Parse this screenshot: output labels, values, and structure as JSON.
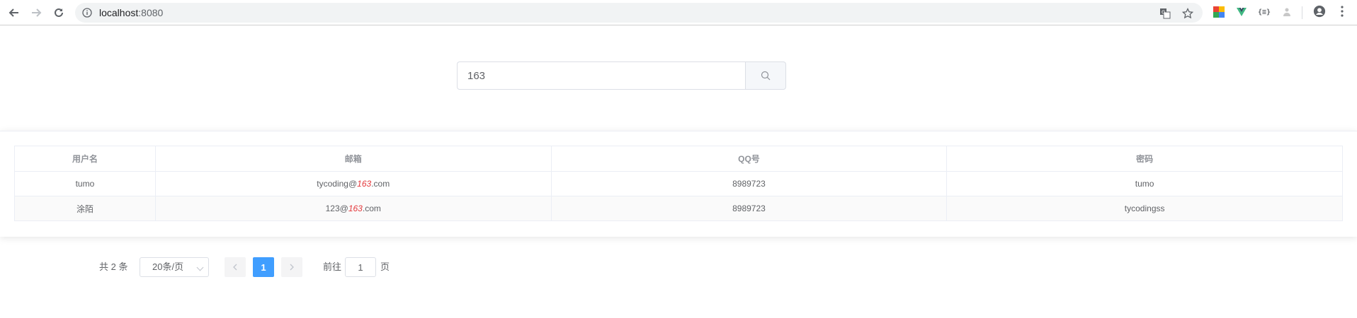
{
  "browser": {
    "url_host": "localhost",
    "url_port": ":8080"
  },
  "search": {
    "value": "163"
  },
  "table": {
    "headers": [
      "用户名",
      "邮箱",
      "QQ号",
      "密码"
    ],
    "rows": [
      {
        "username": "tumo",
        "email_pre": "tycoding@",
        "email_hl": "163",
        "email_post": ".com",
        "qq": "8989723",
        "password": "tumo"
      },
      {
        "username": "涂陌",
        "email_pre": "123@",
        "email_hl": "163",
        "email_post": ".com",
        "qq": "8989723",
        "password": "tycodingss"
      }
    ]
  },
  "pagination": {
    "total": "共 2 条",
    "page_size": "20条/页",
    "current_page": "1",
    "goto_prefix": "前往",
    "goto_value": "1",
    "goto_suffix": "页"
  },
  "colors": {
    "accent": "#409eff",
    "highlight": "#e4393c"
  }
}
